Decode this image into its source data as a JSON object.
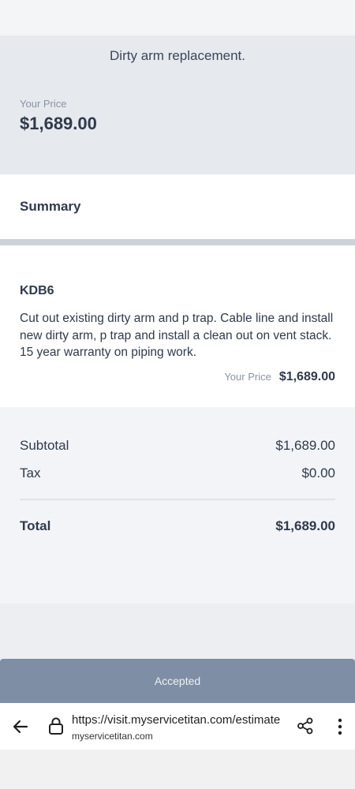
{
  "header": {
    "description": "Dirty arm replacement.",
    "price_label": "Your Price",
    "price_value": "$1,689.00"
  },
  "summary": {
    "title": "Summary"
  },
  "item": {
    "code": "KDB6",
    "description": "Cut out existing dirty arm and p trap. Cable line and install new dirty arm, p trap and install a clean out on vent stack. 15 year warranty on piping work.",
    "price_label": "Your Price",
    "price_value": "$1,689.00"
  },
  "totals": {
    "subtotal_label": "Subtotal",
    "subtotal_value": "$1,689.00",
    "tax_label": "Tax",
    "tax_value": "$0.00",
    "total_label": "Total",
    "total_value": "$1,689.00"
  },
  "status_button": {
    "label": "Accepted"
  },
  "browser": {
    "url": "https://visit.myservicetitan.com/estimate",
    "domain": "myservicetitan.com",
    "icons": [
      "back-arrow-icon",
      "lock-icon",
      "share-icon",
      "more-vert-icon"
    ]
  },
  "colors": {
    "accent_button": "#7e8ea5",
    "header_bg": "#e6e9ee",
    "text": "#2f3a4b"
  }
}
